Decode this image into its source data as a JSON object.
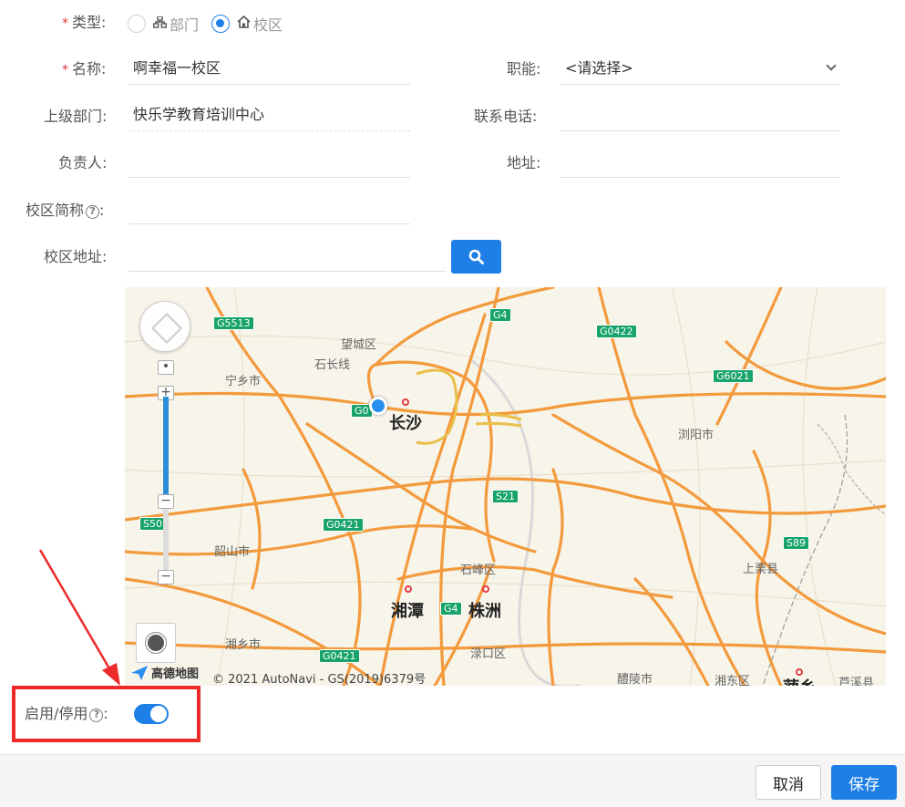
{
  "form": {
    "type_label": "类型:",
    "type_options": [
      {
        "label": "部门",
        "icon": "org-chart-icon",
        "checked": false
      },
      {
        "label": "校区",
        "icon": "home-icon",
        "checked": true
      }
    ],
    "name_label": "名称:",
    "name_value": "啊幸福一校区",
    "function_label": "职能:",
    "function_value": "<请选择>",
    "parent_label": "上级部门:",
    "parent_value": "快乐学教育培训中心",
    "phone_label": "联系电话:",
    "phone_value": "",
    "manager_label": "负责人:",
    "manager_value": "",
    "address_label": "地址:",
    "address_value": "",
    "short_name_label": "校区简称",
    "short_name_value": "",
    "campus_address_label": "校区地址:",
    "campus_address_value": "",
    "enable_label": "启用/停用",
    "enable_on": true,
    "help_icon": "?",
    "colon": ":",
    "required_mark": "*"
  },
  "map": {
    "logo_text": "高德地图",
    "copyright": "© 2021 AutoNavi - GS(2019)6379号",
    "places": [
      {
        "name": "望城区"
      },
      {
        "name": "石长线"
      },
      {
        "name": "宁乡市"
      },
      {
        "name": "长沙"
      },
      {
        "name": "浏阳市"
      },
      {
        "name": "韶山市"
      },
      {
        "name": "石峰区"
      },
      {
        "name": "湘潭"
      },
      {
        "name": "株洲"
      },
      {
        "name": "上栗县"
      },
      {
        "name": "湘乡市"
      },
      {
        "name": "渌口区"
      },
      {
        "name": "醴陵市"
      },
      {
        "name": "湘东区"
      },
      {
        "name": "芦溪县"
      },
      {
        "name": "萍乡"
      }
    ],
    "shields": [
      "G5513",
      "G4",
      "G0422",
      "G6021",
      "G0",
      "S21",
      "S50",
      "G0421",
      "S89",
      "G4",
      "G0421"
    ]
  },
  "footer": {
    "cancel_label": "取消",
    "save_label": "保存"
  },
  "colors": {
    "primary": "#1e7fe6",
    "required": "#e4393c",
    "highlight": "#ec2a2a"
  }
}
